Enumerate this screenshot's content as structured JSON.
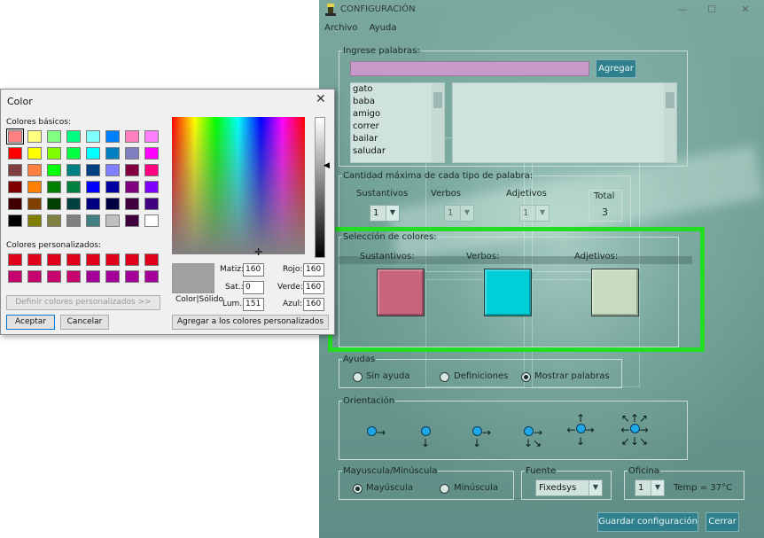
{
  "config_window": {
    "title": "CONFIGURACIÓN",
    "window_buttons": {
      "minimize": "—",
      "maximize": "☐",
      "close": "✕"
    },
    "menu": [
      "Archivo",
      "Ayuda"
    ],
    "words_group": {
      "legend": "Ingrese palabras:",
      "input_value": "",
      "add_button": "Agregar",
      "words": [
        "gato",
        "baba",
        "amigo",
        "correr",
        "bailar",
        "saludar"
      ]
    },
    "max_group": {
      "legend": "Cantidad máxima de cada tipo de palabra:",
      "sustantivos_label": "Sustantivos",
      "verbos_label": "Verbos",
      "adjetivos_label": "Adjetivos",
      "sustantivos_value": "1",
      "verbos_value": "1",
      "adjetivos_value": "1",
      "total_label": "Total",
      "total_value": "3"
    },
    "colors_group": {
      "legend": "Selección de colores:",
      "sustantivos_label": "Sustantivos:",
      "verbos_label": "Verbos:",
      "adjetivos_label": "Adjetivos:",
      "sustantivos_color": "#c8647d",
      "verbos_color": "#00cfd8",
      "adjetivos_color": "#c8dcbf",
      "highlight_color": "#22dd22"
    },
    "help_group": {
      "legend": "Ayudas",
      "options": [
        "Sin ayuda",
        "Definiciones",
        "Mostrar palabras"
      ],
      "selected": "Mostrar palabras"
    },
    "orientation_group": {
      "legend": "Orientación"
    },
    "case_group": {
      "legend": "Mayuscula/Minúscula",
      "options": [
        "Mayúscula",
        "Minúscula"
      ],
      "selected": "Mayúscula"
    },
    "font_group": {
      "legend": "Fuente",
      "value": "Fixedsys"
    },
    "office_group": {
      "legend": "Oficina",
      "value": "1",
      "temp": "Temp = 37°C"
    },
    "save_button": "Guardar configuración",
    "close_button": "Cerrar"
  },
  "color_dialog": {
    "title": "Color",
    "close_glyph": "✕",
    "basic_label": "Colores básicos:",
    "custom_label": "Colores personalizados:",
    "basic_colors": [
      "#ff8080",
      "#ffff80",
      "#80ff80",
      "#00ff80",
      "#80ffff",
      "#0080ff",
      "#ff80c0",
      "#ff80ff",
      "#ff0000",
      "#ffff00",
      "#80ff00",
      "#00ff40",
      "#00ffff",
      "#0080c0",
      "#8080c0",
      "#ff00ff",
      "#804040",
      "#ff8040",
      "#00ff00",
      "#008080",
      "#004080",
      "#8080ff",
      "#800040",
      "#ff0080",
      "#800000",
      "#ff8000",
      "#008000",
      "#008040",
      "#0000ff",
      "#0000a0",
      "#800080",
      "#8000ff",
      "#400000",
      "#804000",
      "#004000",
      "#004040",
      "#000080",
      "#000040",
      "#400040",
      "#400080",
      "#000000",
      "#808000",
      "#808040",
      "#808080",
      "#408080",
      "#c0c0c0",
      "#400040",
      "#ffffff"
    ],
    "custom_colors": [
      "#e0001c",
      "#e0001c",
      "#e0001c",
      "#e0001c",
      "#e0001c",
      "#e0001c",
      "#e0001c",
      "#e0001c",
      "#c8006e",
      "#c8006e",
      "#c8006e",
      "#c8006e",
      "#a6009a",
      "#a6009a",
      "#a6009a",
      "#a6009a"
    ],
    "define_button": "Definir colores personalizados >>",
    "accept_button": "Aceptar",
    "cancel_button": "Cancelar",
    "preview_label": "Color|Sólido",
    "preview_color": "#a0a0a0",
    "fields": {
      "matiz_label": "Matiz:",
      "matiz_value": "160",
      "sat_label": "Sat.:",
      "sat_value": "0",
      "lum_label": "Lum.:",
      "lum_value": "151",
      "rojo_label": "Rojo:",
      "rojo_value": "160",
      "verde_label": "Verde:",
      "verde_value": "160",
      "azul_label": "Azul:",
      "azul_value": "160"
    },
    "add_custom_button": "Agregar a los colores personalizados"
  }
}
